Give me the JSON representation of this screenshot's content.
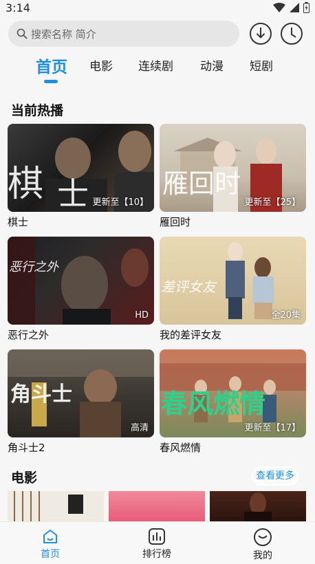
{
  "status_bar": {
    "time": "3:14"
  },
  "search": {
    "placeholder": "搜索名称 简介"
  },
  "tabs": [
    {
      "label": "首页",
      "active": true
    },
    {
      "label": "电影",
      "active": false
    },
    {
      "label": "连续剧",
      "active": false
    },
    {
      "label": "动漫",
      "active": false
    },
    {
      "label": "短剧",
      "active": false
    }
  ],
  "hot_section": {
    "title": "当前热播",
    "items": [
      {
        "title": "棋士",
        "badge": "更新至【10】"
      },
      {
        "title": "雁回时",
        "badge": "更新至【25】"
      },
      {
        "title": "恶行之外",
        "badge": "HD",
        "poster_text": "恶行之外"
      },
      {
        "title": "我的差评女友",
        "badge": "全20集"
      },
      {
        "title": "角斗士2",
        "badge": "高清",
        "poster_text": "角斗士"
      },
      {
        "title": "春风燃情",
        "badge": "更新至【17】"
      }
    ]
  },
  "movie_section": {
    "title": "电影",
    "more_label": "查看更多"
  },
  "bottom_nav": [
    {
      "label": "首页",
      "icon": "home-icon",
      "active": true
    },
    {
      "label": "排行榜",
      "icon": "chart-icon",
      "active": false
    },
    {
      "label": "我的",
      "icon": "profile-icon",
      "active": false
    }
  ],
  "colors": {
    "accent": "#1e8ee0",
    "background": "#f6f6f6"
  }
}
